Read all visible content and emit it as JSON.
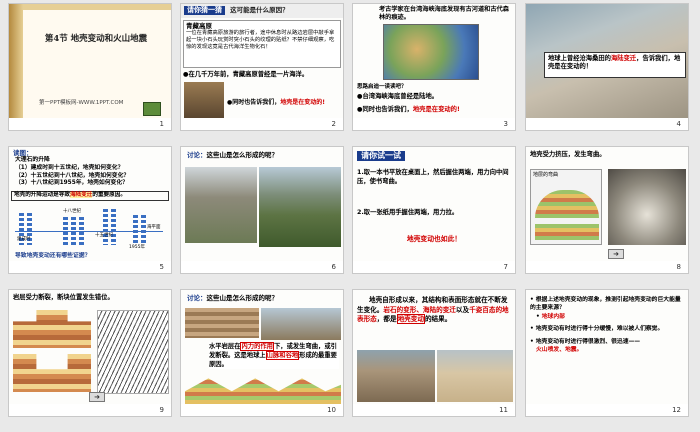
{
  "slides": [
    {
      "num": "1",
      "title": "第4节  地壳变动和火山地震",
      "footer": "第一PPT模板网-WWW.1PPT.COM"
    },
    {
      "num": "2",
      "header": "请你猜一猜",
      "question": "这可能是什么原因？",
      "box_title": "青藏高原",
      "box_text": "一位在青藏高原旅游的旅行者，途中休息时从路边岩层中敲手拿起一块小石头玩赏时突小石头的纹理的贴纸？不禁仔细观察，吃惊的发现这竟是古代海洋生物化石！",
      "bullet1": "●在几千万年前，青藏高原曾经是一片海洋。",
      "bullet2_prefix": "●同时也告诉我们，",
      "bullet2_hl": "地壳是在变动的!"
    },
    {
      "num": "3",
      "intro": "考古学家在台湾海峡海底发现有古河道和古代森林的痕迹。",
      "q": "思路启迪一读读吧？",
      "b1": "●台湾海峡海底曾经是陆地。",
      "b2_prefix": "●同时也告诉我们，",
      "b2_hl": "地壳是在变动的!"
    },
    {
      "num": "4",
      "caption_prefix": "地球上曾经沧海桑田的",
      "caption_hl": "海陆变迁",
      "caption_suffix": "，告诉我们，地壳是在变动的！"
    },
    {
      "num": "5",
      "title": "读图：",
      "lines": [
        "大理石的升降",
        "（1）建成时到十五世纪，地壳如何变化？",
        "（2）十五世纪到十八世纪，地壳如何变化？",
        "（3）十八世纪到1955年，地壳如何变化？"
      ],
      "note_prefix": "地壳的升降运动是导致",
      "note_hl": "海陆变迁",
      "note_suffix": "的重要原因。",
      "bottom": "导致地壳变动还有哪些证据？",
      "labels": [
        "建成时",
        "十五世纪",
        "十八世纪",
        "1955年",
        "海平面"
      ]
    },
    {
      "num": "6",
      "prompt_label": "讨论：",
      "prompt": "这些山是怎么形成的呢？"
    },
    {
      "num": "7",
      "header": "请你试一试",
      "step1": "1.取一本书平放在桌面上，然后握住两端，用力向中间压，使书弯曲。",
      "step2": "2.取一张纸用手握住两端，用力拉。",
      "conclusion": "地壳变动也如此！"
    },
    {
      "num": "8",
      "caption": "地壳受力挤压，发生弯曲。",
      "inner_label": "地层的弯曲"
    },
    {
      "num": "9",
      "caption": "岩层受力断裂，断块位置发生错位。"
    },
    {
      "num": "10",
      "prompt_label": "讨论：",
      "prompt": "这些山是怎么形成的呢？",
      "text1_prefix": "水平岩层在",
      "text1_hl": "内力的作用",
      "text1_suffix": "下，或发生弯曲，或引发断裂。这是地球上",
      "text2_hl": "山脉和谷地",
      "text2_suffix": "形成的最重要原因。"
    },
    {
      "num": "11",
      "p1": "地壳自形成以来，其结构和表面形态就在不断发生变化。",
      "p1_hl": "岩石的变形、海陆的变迁",
      "p2_mid": "以及",
      "p2_hl": "千姿百态的地表形态",
      "p2_suffix": "，都是",
      "p3_hl": "地壳变动",
      "p3_suffix": "的结果。"
    },
    {
      "num": "12",
      "b1": "根据上述地壳变动的现象，推测引起地壳变动的巨大能量的主要来源？",
      "b1_ans": "地球内部",
      "b2": "地壳变动有时进行得十分缓慢，难以被人们察觉。",
      "b3": "地壳变动有时进行得很激烈、很迅速——",
      "b3_hl": "火山喷发、地震。"
    }
  ],
  "colors": {
    "red": "#d10000",
    "blue_header": "#1a3c8c",
    "gold": "#b48a3e"
  }
}
